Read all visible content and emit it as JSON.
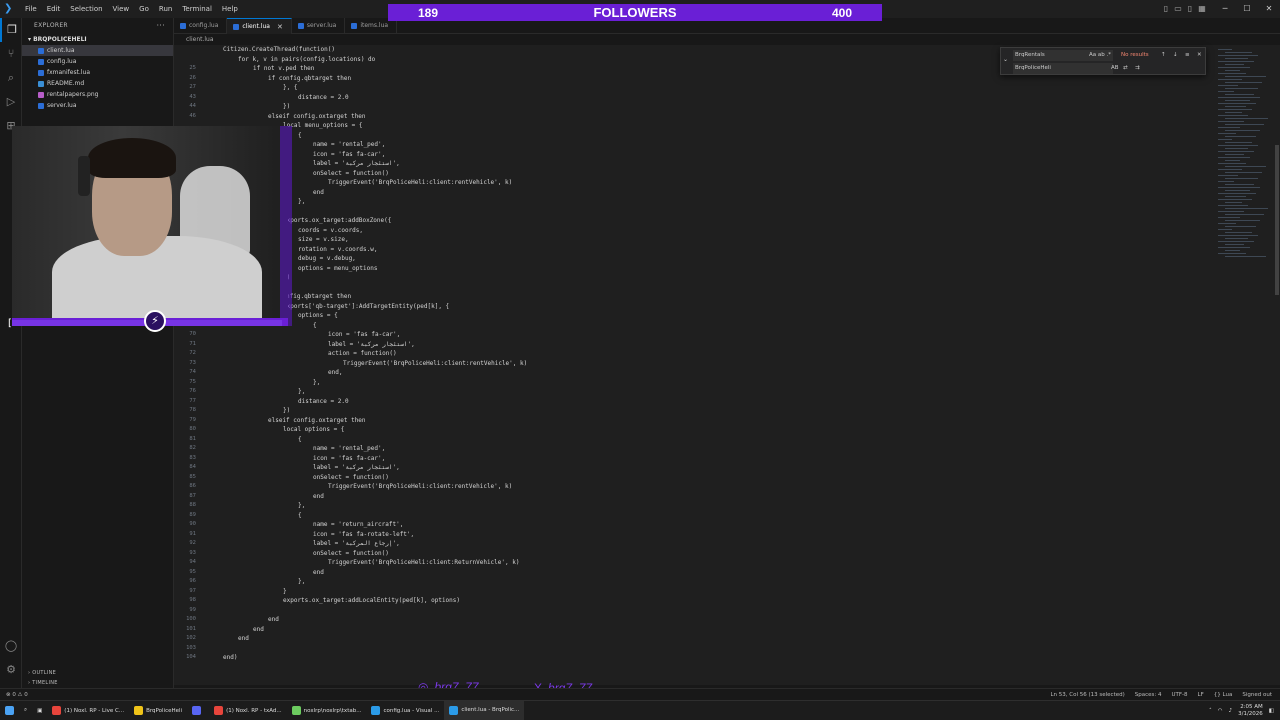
{
  "titlebar": {
    "menu": [
      "File",
      "Edit",
      "Selection",
      "View",
      "Go",
      "Run",
      "Terminal",
      "Help"
    ],
    "logo": "vscode-icon"
  },
  "followers": {
    "left": "189",
    "label": "FOLLOWERS",
    "right": "400"
  },
  "sidebar": {
    "header": "EXPLORER",
    "folder": "BRQPOLICEHELI",
    "files": [
      {
        "name": "client.lua",
        "color": "#2b6dd6",
        "selected": true
      },
      {
        "name": "config.lua",
        "color": "#2b6dd6",
        "selected": false
      },
      {
        "name": "fxmanifest.lua",
        "color": "#2b6dd6",
        "selected": false
      },
      {
        "name": "README.md",
        "color": "#3a8fd6",
        "selected": false
      },
      {
        "name": "rentalpapers.png",
        "color": "#b85ec9",
        "selected": false
      },
      {
        "name": "server.lua",
        "color": "#2b6dd6",
        "selected": false
      }
    ],
    "outline": "OUTLINE",
    "timeline": "TIMELINE"
  },
  "tabs": [
    {
      "label": "config.lua",
      "active": false
    },
    {
      "label": "client.lua",
      "active": true
    },
    {
      "label": "server.lua",
      "active": false
    },
    {
      "label": "items.lua",
      "active": false
    }
  ],
  "breadcrumb": "client.lua",
  "editor_lines": [
    {
      "n": "",
      "t": "Citizen.CreateThread(function()",
      "i": 1
    },
    {
      "n": "",
      "t": "for k, v in pairs(config.locations) do",
      "i": 2
    },
    {
      "n": "25",
      "t": "if not v.ped then",
      "i": 3
    },
    {
      "n": "26",
      "t": "if config.qbtarget then",
      "i": 4
    },
    {
      "n": "27",
      "t": "}, {",
      "i": 5
    },
    {
      "n": "43",
      "t": "distance = 2.0",
      "i": 6
    },
    {
      "n": "44",
      "t": "})",
      "i": 5
    },
    {
      "n": "46",
      "t": "elseif config.oxtarget then",
      "i": 4
    },
    {
      "n": "",
      "t": "local menu_options = {",
      "i": 5
    },
    {
      "n": "",
      "t": "{",
      "i": 6
    },
    {
      "n": "",
      "t": "name = 'rental_ped',",
      "i": 7
    },
    {
      "n": "",
      "t": "icon = 'fas fa-car',",
      "i": 7
    },
    {
      "n": "",
      "t": "label = 'استئجار مركبة',",
      "i": 7
    },
    {
      "n": "",
      "t": "onSelect = function()",
      "i": 7
    },
    {
      "n": "",
      "t": "TriggerEvent('BrqPoliceHeli:client:rentVehicle', k)",
      "i": 8
    },
    {
      "n": "",
      "t": "end",
      "i": 7
    },
    {
      "n": "",
      "t": "},",
      "i": 6
    },
    {
      "n": "",
      "t": "",
      "i": 5
    },
    {
      "n": "",
      "t": "exports.ox_target:addBoxZone({",
      "i": 5
    },
    {
      "n": "",
      "t": "coords = v.coords,",
      "i": 6
    },
    {
      "n": "",
      "t": "size = v.size,",
      "i": 6
    },
    {
      "n": "",
      "t": "rotation = v.coords.w,",
      "i": 6
    },
    {
      "n": "",
      "t": "debug = v.debug,",
      "i": 6
    },
    {
      "n": "",
      "t": "options = menu_options",
      "i": 6
    },
    {
      "n": "",
      "t": "})",
      "i": 5
    },
    {
      "n": "",
      "t": "",
      "i": 5
    },
    {
      "n": "",
      "t": "if config.qbtarget then",
      "i": 4
    },
    {
      "n": "",
      "t": "exports['qb-target']:AddTargetEntity(ped[k], {",
      "i": 5
    },
    {
      "n": "",
      "t": "options = {",
      "i": 6
    },
    {
      "n": "69",
      "t": "{",
      "i": 7
    },
    {
      "n": "70",
      "t": "icon = 'fas fa-car',",
      "i": 8
    },
    {
      "n": "71",
      "t": "label = 'استئجار مركبة',",
      "i": 8
    },
    {
      "n": "72",
      "t": "action = function()",
      "i": 8
    },
    {
      "n": "73",
      "t": "TriggerEvent('BrqPoliceHeli:client:rentVehicle', k)",
      "i": 9
    },
    {
      "n": "74",
      "t": "end,",
      "i": 8
    },
    {
      "n": "75",
      "t": "},",
      "i": 7
    },
    {
      "n": "76",
      "t": "},",
      "i": 6
    },
    {
      "n": "77",
      "t": "distance = 2.0",
      "i": 6
    },
    {
      "n": "78",
      "t": "})",
      "i": 5
    },
    {
      "n": "79",
      "t": "elseif config.oxtarget then",
      "i": 4
    },
    {
      "n": "80",
      "t": "local options = {",
      "i": 5
    },
    {
      "n": "81",
      "t": "{",
      "i": 6
    },
    {
      "n": "82",
      "t": "name = 'rental_ped',",
      "i": 7
    },
    {
      "n": "83",
      "t": "icon = 'fas fa-car',",
      "i": 7
    },
    {
      "n": "84",
      "t": "label = 'استئجار مركبة',",
      "i": 7
    },
    {
      "n": "85",
      "t": "onSelect = function()",
      "i": 7
    },
    {
      "n": "86",
      "t": "TriggerEvent('BrqPoliceHeli:client:rentVehicle', k)",
      "i": 8
    },
    {
      "n": "87",
      "t": "end",
      "i": 7
    },
    {
      "n": "88",
      "t": "},",
      "i": 6
    },
    {
      "n": "89",
      "t": "{",
      "i": 6
    },
    {
      "n": "90",
      "t": "name = 'return_aircraft',",
      "i": 7
    },
    {
      "n": "91",
      "t": "icon = 'fas fa-rotate-left',",
      "i": 7
    },
    {
      "n": "92",
      "t": "label = 'إرجاع المركبة',",
      "i": 7
    },
    {
      "n": "93",
      "t": "onSelect = function()",
      "i": 7
    },
    {
      "n": "94",
      "t": "TriggerEvent('BrqPoliceHeli:client:ReturnVehicle', k)",
      "i": 8
    },
    {
      "n": "95",
      "t": "end",
      "i": 7
    },
    {
      "n": "96",
      "t": "},",
      "i": 6
    },
    {
      "n": "97",
      "t": "}",
      "i": 5
    },
    {
      "n": "98",
      "t": "exports.ox_target:addLocalEntity(ped[k], options)",
      "i": 5
    },
    {
      "n": "99",
      "t": "",
      "i": 4
    },
    {
      "n": "100",
      "t": "end",
      "i": 4
    },
    {
      "n": "101",
      "t": "end",
      "i": 3
    },
    {
      "n": "102",
      "t": "end",
      "i": 2
    },
    {
      "n": "103",
      "t": "",
      "i": 1
    },
    {
      "n": "104",
      "t": "end)",
      "i": 1
    }
  ],
  "find": {
    "search": "BrqRentals",
    "replace": "BrqPoliceHeli",
    "status": "No results",
    "opts_search": "Aa  ab  .*",
    "opts_replace": "AB"
  },
  "socials": [
    {
      "icon": "instagram-icon",
      "glyph": "◎",
      "handle": "brq7_77"
    },
    {
      "icon": "x-icon",
      "glyph": "X",
      "handle": "brq7_77"
    },
    {
      "icon": "tiktok-icon",
      "glyph": "♪",
      "handle": "brq7_77"
    }
  ],
  "statusbar": {
    "left": "⊗ 0 ⚠ 0",
    "items": [
      "Ln 53, Col 56 (13 selected)",
      "Spaces: 4",
      "UTF-8",
      "LF",
      "{} Lua",
      "Signed out"
    ]
  },
  "taskbar": {
    "items": [
      {
        "label": "(1) Noxl. RP - Live C...",
        "color": "#e8453c",
        "active": false
      },
      {
        "label": "BrqPoliceHeli",
        "color": "#f0c419",
        "active": false
      },
      {
        "label": "",
        "color": "#5865f2",
        "active": false
      },
      {
        "label": "(1) Noxl. RP - txAd...",
        "color": "#e8453c",
        "active": false
      },
      {
        "label": "noxlrp\\noxlrp\\txtab...",
        "color": "#6ccb5f",
        "active": false
      },
      {
        "label": "config.lua - Visual ...",
        "color": "#2b9be8",
        "active": false
      },
      {
        "label": "client.lua - BrqPolic...",
        "color": "#2b9be8",
        "active": true
      }
    ],
    "time": "2:05 AM",
    "date": "3/1/2026"
  }
}
